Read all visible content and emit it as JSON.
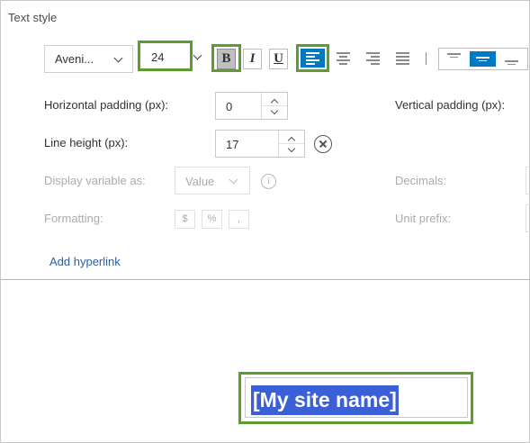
{
  "panel": {
    "title": "Text style"
  },
  "toolbar": {
    "font_family_value": "Aveni...",
    "font_size_value": "24",
    "bold_label": "B",
    "italic_label": "I",
    "underline_label": "U",
    "bold_active": true,
    "horizontal_alignment_active": "left",
    "vertical_alignment_active": "middle",
    "accent_color": "#0079c1",
    "highlight_border_color": "#5e9c2e"
  },
  "form": {
    "horizontal_padding": {
      "label": "Horizontal padding (px):",
      "value": "0"
    },
    "vertical_padding": {
      "label": "Vertical padding (px):"
    },
    "line_height": {
      "label": "Line height (px):",
      "value": "17"
    },
    "display_variable": {
      "label": "Display variable as:",
      "value": "Value"
    },
    "decimals": {
      "label": "Decimals:"
    },
    "formatting": {
      "label": "Formatting:",
      "buttons": [
        "$",
        "%",
        ","
      ]
    },
    "unit_prefix": {
      "label": "Unit prefix:"
    }
  },
  "links": {
    "add_hyperlink": "Add hyperlink"
  },
  "canvas": {
    "text_element": "[My site name]",
    "selection_color": "#3b5fd6"
  }
}
